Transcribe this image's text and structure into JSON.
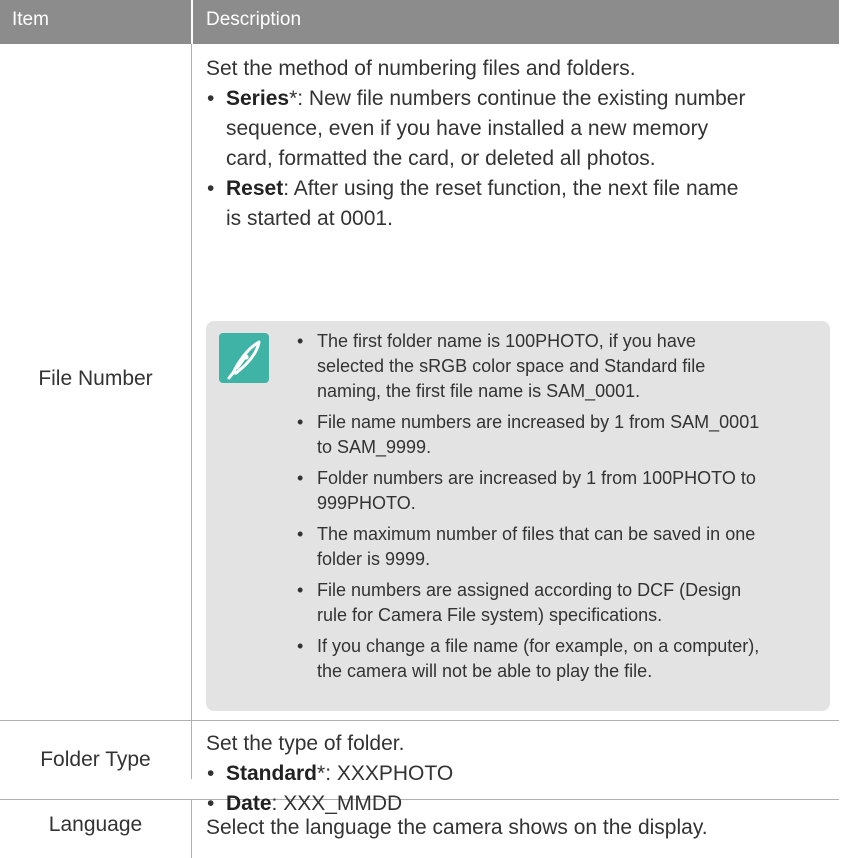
{
  "header": {
    "item_label": "Item",
    "description_label": "Description"
  },
  "rows": [
    {
      "item": "File Number",
      "intro": "Set the method of numbering files and folders.",
      "bullets": [
        {
          "term": "Series",
          "suffix": "*:",
          "lines": [
            " New file numbers continue the existing number",
            "sequence, even if you have installed a new memory",
            "card, formatted the card, or deleted all photos."
          ]
        },
        {
          "term": "Reset",
          "suffix": ":",
          "lines": [
            " After using the reset function, the next file name",
            "is started at 0001."
          ]
        }
      ],
      "note": {
        "icon": "pen-nib-icon",
        "icon_color": "#3fb4a6",
        "items": [
          [
            "The first folder name is 100PHOTO, if you have",
            "selected the sRGB color space and Standard file",
            "naming, the first file name is SAM_0001."
          ],
          [
            "File name numbers are increased by 1 from SAM_0001",
            "to SAM_9999."
          ],
          [
            "Folder numbers are increased by 1 from 100PHOTO to",
            "999PHOTO."
          ],
          [
            "The maximum number of files that can be saved in one",
            "folder is 9999."
          ],
          [
            "File numbers are assigned according to DCF (Design",
            "rule for Camera File system) specifications."
          ],
          [
            "If you change a file name (for example, on a computer),",
            "the camera will not be able to play the file."
          ]
        ]
      }
    },
    {
      "item": "Folder Type",
      "intro": "Set the type of folder.",
      "bullets": [
        {
          "term": "Standard",
          "suffix": "*:",
          "lines": [
            " XXXPHOTO"
          ]
        },
        {
          "term": "Date",
          "suffix": ":",
          "lines": [
            " XXX_MMDD"
          ]
        }
      ]
    },
    {
      "item": "Language",
      "intro": "Select the language the camera shows on the display."
    }
  ],
  "bullet_char": "•",
  "colors": {
    "header_bg": "#8c8c8c",
    "note_bg": "#e3e3e3",
    "accent": "#3fb4a6"
  }
}
